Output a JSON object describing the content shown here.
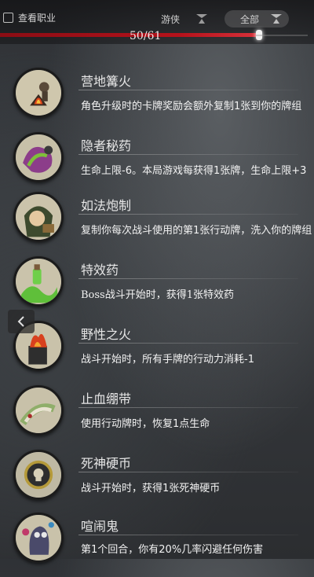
{
  "top_bar": {
    "checkbox_label": "查看职业",
    "filter_class": "游侠",
    "filter_all": "全部",
    "hp_text": "50/61",
    "hp_fraction": 0.82
  },
  "items": [
    {
      "title": "营地篝火",
      "desc": "角色升级时的卡牌奖励会额外复制1张到你的牌组",
      "icon": "campfire-icon"
    },
    {
      "title": "隐者秘药",
      "desc": "生命上限-6。本局游戏每获得1张牌，生命上限+3",
      "icon": "hermit-potion-icon"
    },
    {
      "title": "如法炮制",
      "desc": "复制你每次战斗使用的第1张行动牌，洗入你的牌组",
      "icon": "copycat-icon"
    },
    {
      "title": "特效药",
      "desc": "Boss战斗开始时，获得1张特效药",
      "icon": "special-medicine-icon"
    },
    {
      "title": "野性之火",
      "desc": "战斗开始时，所有手牌的行动力消耗-1",
      "icon": "wild-fire-icon"
    },
    {
      "title": "止血绷带",
      "desc": "使用行动牌时，恢复1点生命",
      "icon": "bandage-icon"
    },
    {
      "title": "死神硬币",
      "desc": "战斗开始时，获得1张死神硬币",
      "icon": "death-coin-icon"
    },
    {
      "title": "喧闹鬼",
      "desc": "第1个回合，你有20%几率闪避任何伤害",
      "icon": "poltergeist-icon"
    }
  ]
}
